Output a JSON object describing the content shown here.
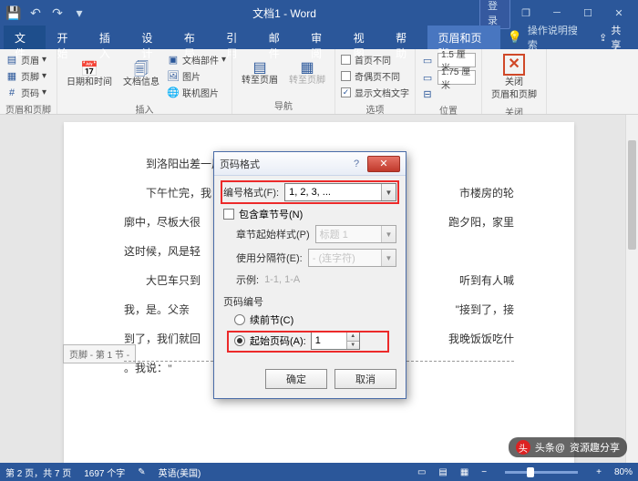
{
  "title": "文档1 - Word",
  "qat": {
    "save": "💾",
    "undo": "↶",
    "redo": "↷",
    "down": "▾"
  },
  "win": {
    "login": "登录",
    "min": "─",
    "max": "☐",
    "close": "✕",
    "rest": "❐"
  },
  "menu": {
    "file": "文件",
    "home": "开始",
    "insert": "插入",
    "design": "设计",
    "layout": "布局",
    "references": "引用",
    "mailings": "邮件",
    "review": "审阅",
    "view": "视图",
    "help": "帮助",
    "hf": "页眉和页脚",
    "tell": "操作说明搜索",
    "share": "共享"
  },
  "ribbon": {
    "header": "页眉",
    "footer": "页脚",
    "pagenum": "页码",
    "datetime": "日期和时间",
    "docinfo": "文档信息",
    "quickparts": "文档部件",
    "picture": "图片",
    "online": "联机图片",
    "gotohdr": "转至页眉",
    "gotoftr": "转至页脚",
    "difffirst": "首页不同",
    "diffodd": "奇偶页不同",
    "showdoc": "显示文档文字",
    "topdist": "1.5 厘米",
    "botdist": "1.75 厘米",
    "close_l1": "关闭",
    "close_l2": "页眉和页脚",
    "g_hf": "页眉和页脚",
    "g_insert": "插入",
    "g_nav": "导航",
    "g_options": "选项",
    "g_position": "位置",
    "g_close": "关闭"
  },
  "doc": {
    "p1": "到洛阳出差一周了。↲",
    "p2": "下午忙完，我",
    "p3": "廓中，尽板大很",
    "p4": "这时候，风是轻",
    "p5": "大巴车只到",
    "p6": "我，是。父亲",
    "p7": "到了，我们就回",
    "p8": "。我说：\"",
    "r2": "市楼房的轮",
    "r3": "跑夕阳，家里",
    "r5": "听到有人喊",
    "r6": "\"接到了，接",
    "r7": "我晚饭饭吃什",
    "footer_tag": "页脚 - 第 1 节 -"
  },
  "dialog": {
    "title": "页码格式",
    "fmt_label": "编号格式(F):",
    "fmt_value": "1, 2, 3, ...",
    "include_chapter": "包含章节号(N)",
    "chapter_style_label": "章节起始样式(P)",
    "chapter_style_value": "标题 1",
    "separator_label": "使用分隔符(E):",
    "separator_value": "- (连字符)",
    "example_label": "示例:",
    "example_value": "1-1, 1-A",
    "section": "页码编号",
    "continue": "续前节(C)",
    "startat": "起始页码(A):",
    "startat_value": "1",
    "ok": "确定",
    "cancel": "取消"
  },
  "status": {
    "page": "第 2 页，共 7 页",
    "words": "1697 个字",
    "lang": "英语(美国)",
    "zoom": "80%"
  },
  "watermark": "资源趣分享"
}
